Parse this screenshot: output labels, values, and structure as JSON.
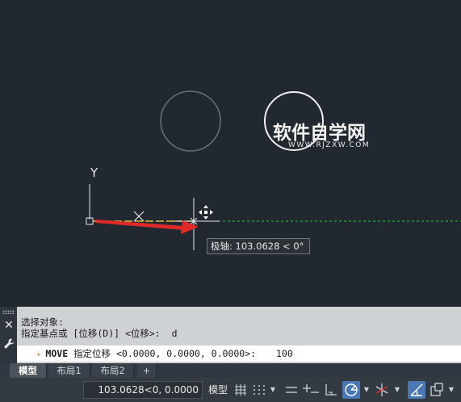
{
  "watermark": {
    "title": "软件自学网",
    "subtitle": "WWW.RJZXW.COM"
  },
  "canvas": {
    "y_axis_label": "Y",
    "tooltip": "极轴: 103.0628 < 0°"
  },
  "command": {
    "history": [
      "选择对象:",
      "指定基点或 [位移(D)] <位移>:  d"
    ],
    "prompt_caret": "▾",
    "command_name": "MOVE",
    "prompt_text": "指定位移 <0.0000, 0.0000, 0.0000>:",
    "input_value": "100",
    "close_glyph": "✕"
  },
  "tabs": [
    {
      "label": "模型",
      "active": true
    },
    {
      "label": "布局1",
      "active": false
    },
    {
      "label": "布局2",
      "active": false
    },
    {
      "label": "+",
      "active": false
    }
  ],
  "status": {
    "coordinates": "103.0628<0, 0.0000",
    "model_label": "模型",
    "icons": [
      "grid-icon",
      "snap-icon",
      "infer-icon",
      "ortho-icon",
      "polar-icon",
      "isodraft-icon",
      "object-snap-tracking-icon",
      "annotation-icon",
      "selection-cycling-icon"
    ]
  },
  "colors": {
    "canvas_bg": "#212830",
    "arrow_red": "#e02a2a",
    "tracking_green": "#33c24a",
    "object_yellow": "#d8c640",
    "status_active_blue": "#4a78b4"
  }
}
